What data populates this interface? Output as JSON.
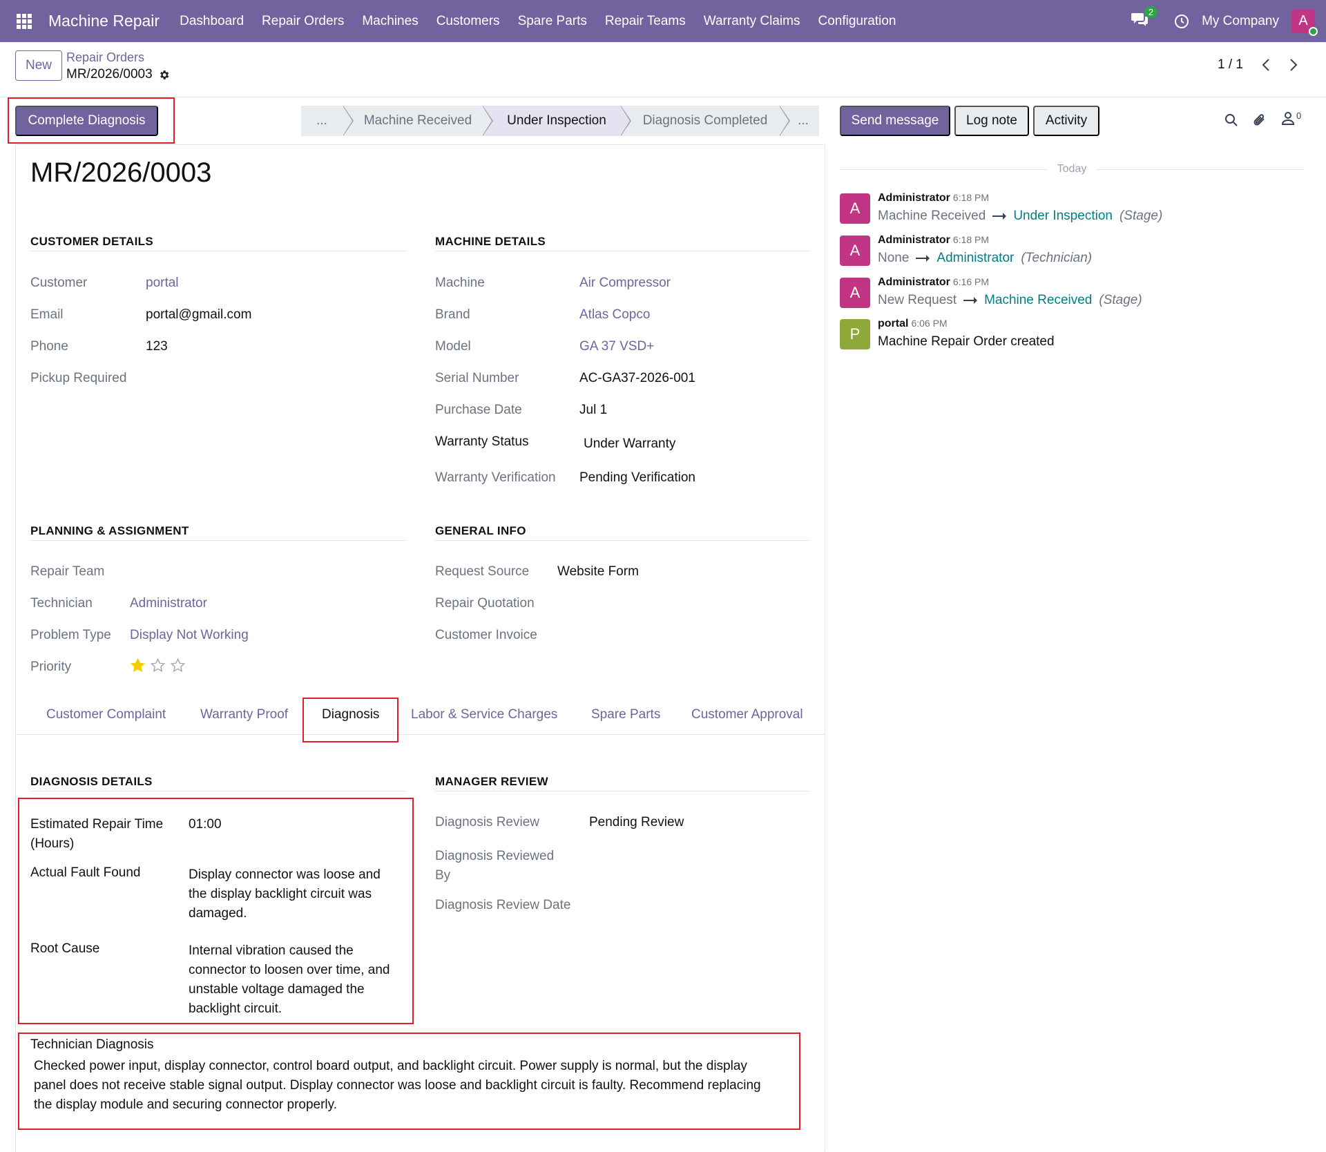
{
  "navbar": {
    "app_name": "Machine Repair",
    "menu": [
      "Dashboard",
      "Repair Orders",
      "Machines",
      "Customers",
      "Spare Parts",
      "Repair Teams",
      "Warranty Claims",
      "Configuration"
    ],
    "messages_count": "2",
    "company": "My Company",
    "user_initial": "A"
  },
  "control": {
    "new_label": "New",
    "breadcrumb_parent": "Repair Orders",
    "breadcrumb_current": "MR/2026/0003",
    "pager": "1 / 1"
  },
  "actions": {
    "primary_button": "Complete Diagnosis"
  },
  "statusbar": {
    "stages": [
      "...",
      "Machine Received",
      "Under Inspection",
      "Diagnosis Completed",
      "..."
    ],
    "active": "Under Inspection"
  },
  "record": {
    "title": "MR/2026/0003"
  },
  "customer_details": {
    "heading": "CUSTOMER DETAILS",
    "customer_label": "Customer",
    "customer": "portal",
    "email_label": "Email",
    "email": "portal@gmail.com",
    "phone_label": "Phone",
    "phone": "123",
    "pickup_label": "Pickup Required"
  },
  "machine_details": {
    "heading": "MACHINE DETAILS",
    "machine_label": "Machine",
    "machine": "Air Compressor",
    "brand_label": "Brand",
    "brand": "Atlas Copco",
    "model_label": "Model",
    "model": "GA 37 VSD+",
    "serial_label": "Serial Number",
    "serial": "AC-GA37-2026-001",
    "purchase_label": "Purchase Date",
    "purchase": "Jul 1",
    "warranty_status_label": "Warranty Status",
    "warranty_status": "Under Warranty",
    "warranty_verif_label": "Warranty Verification",
    "warranty_verif": "Pending Verification"
  },
  "planning": {
    "heading": "PLANNING & ASSIGNMENT",
    "team_label": "Repair Team",
    "technician_label": "Technician",
    "technician": "Administrator",
    "problem_label": "Problem Type",
    "problem": "Display Not Working",
    "priority_label": "Priority",
    "priority_stars": 1,
    "priority_max": 3
  },
  "general_info": {
    "heading": "GENERAL INFO",
    "source_label": "Request Source",
    "source": "Website Form",
    "quotation_label": "Repair Quotation",
    "invoice_label": "Customer Invoice"
  },
  "tabs": [
    "Customer Complaint",
    "Warranty Proof",
    "Diagnosis",
    "Labor & Service Charges",
    "Spare Parts",
    "Customer Approval"
  ],
  "active_tab": "Diagnosis",
  "diagnosis": {
    "heading": "DIAGNOSIS DETAILS",
    "est_time_label_1": "Estimated Repair Time",
    "est_time_label_2": "(Hours)",
    "est_time": "01:00",
    "fault_label": "Actual Fault Found",
    "fault_lines": [
      "Display connector was loose and",
      "the display backlight circuit was",
      "damaged."
    ],
    "root_label": "Root Cause",
    "root_lines": [
      "Internal vibration caused the",
      "connector to loosen over time, and",
      "unstable voltage damaged the",
      "backlight circuit."
    ],
    "tech_label": "Technician Diagnosis",
    "tech_lines": [
      "Checked power input, display connector, control board output, and backlight circuit. Power supply is normal, but the display",
      "panel does not receive stable signal output. Display connector was loose and backlight circuit is faulty. Recommend replacing",
      "the display module and securing connector properly."
    ]
  },
  "manager_review": {
    "heading": "MANAGER REVIEW",
    "review_label": "Diagnosis Review",
    "review": "Pending Review",
    "reviewed_by_label_1": "Diagnosis Reviewed",
    "reviewed_by_label_2": "By",
    "review_date_label": "Diagnosis Review Date"
  },
  "chatter": {
    "send_message": "Send message",
    "log_note": "Log note",
    "activity": "Activity",
    "followers_count": "0",
    "date_separator": "Today",
    "messages": [
      {
        "initial": "A",
        "author": "Administrator",
        "time": "6:18 PM",
        "old": "Machine Received",
        "new": "Under Inspection",
        "field": "(Stage)"
      },
      {
        "initial": "A",
        "author": "Administrator",
        "time": "6:18 PM",
        "old": "None",
        "new": "Administrator",
        "field": "(Technician)"
      },
      {
        "initial": "A",
        "author": "Administrator",
        "time": "6:16 PM",
        "old": "New Request",
        "new": "Machine Received",
        "field": "(Stage)"
      },
      {
        "initial": "P",
        "author": "portal",
        "time": "6:06 PM",
        "text": "Machine Repair Order created"
      }
    ]
  },
  "colors": {
    "brand": "#71639e",
    "highlight": "#e11d27",
    "link_chatter": "#017e84",
    "avatar_admin": "#c13584",
    "avatar_portal": "#8ea83a"
  }
}
